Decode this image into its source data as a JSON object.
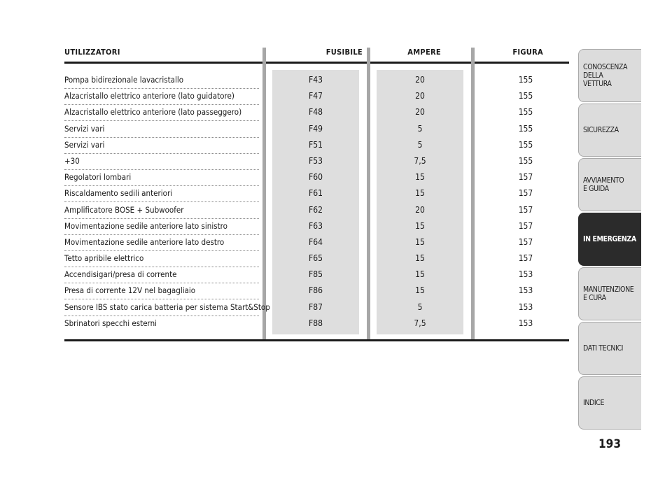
{
  "table": {
    "headers": {
      "utilizzatori": "UTILIZZATORI",
      "fusibile": "FUSIBILE",
      "ampere": "AMPERE",
      "figura": "FIGURA"
    },
    "rows": [
      {
        "desc": "Pompa bidirezionale lavacristallo",
        "fuse": "F43",
        "amp": "20",
        "fig": "155"
      },
      {
        "desc": "Alzacristallo elettrico anteriore (lato guidatore)",
        "fuse": "F47",
        "amp": "20",
        "fig": "155"
      },
      {
        "desc": "Alzacristallo elettrico anteriore (lato passeggero)",
        "fuse": "F48",
        "amp": "20",
        "fig": "155"
      },
      {
        "desc": "Servizi vari",
        "fuse": "F49",
        "amp": "5",
        "fig": "155"
      },
      {
        "desc": "Servizi vari",
        "fuse": "F51",
        "amp": "5",
        "fig": "155"
      },
      {
        "desc": "+30",
        "fuse": "F53",
        "amp": "7,5",
        "fig": "155"
      },
      {
        "desc": "Regolatori lombari",
        "fuse": "F60",
        "amp": "15",
        "fig": "157"
      },
      {
        "desc": "Riscaldamento sedili anteriori",
        "fuse": "F61",
        "amp": "15",
        "fig": "157"
      },
      {
        "desc": "Amplificatore BOSE + Subwoofer",
        "fuse": "F62",
        "amp": "20",
        "fig": "157"
      },
      {
        "desc": "Movimentazione sedile anteriore lato sinistro",
        "fuse": "F63",
        "amp": "15",
        "fig": "157"
      },
      {
        "desc": "Movimentazione sedile anteriore lato destro",
        "fuse": "F64",
        "amp": "15",
        "fig": "157"
      },
      {
        "desc": "Tetto apribile elettrico",
        "fuse": "F65",
        "amp": "15",
        "fig": "157"
      },
      {
        "desc": "Accendisigari/presa di corrente",
        "fuse": "F85",
        "amp": "15",
        "fig": "153"
      },
      {
        "desc": "Presa di corrente 12V nel bagagliaio",
        "fuse": "F86",
        "amp": "15",
        "fig": "153"
      },
      {
        "desc": "Sensore IBS stato carica batteria per sistema Start&Stop",
        "fuse": "F87",
        "amp": "5",
        "fig": "153"
      },
      {
        "desc": "Sbrinatori specchi esterni",
        "fuse": "F88",
        "amp": "7,5",
        "fig": "153"
      }
    ]
  },
  "tabs": [
    {
      "label": "CONOSCENZA\nDELLA\nVETTURA",
      "active": false
    },
    {
      "label": "SICUREZZA",
      "active": false
    },
    {
      "label": "AVVIAMENTO\nE GUIDA",
      "active": false
    },
    {
      "label": "IN EMERGENZA",
      "active": true
    },
    {
      "label": "MANUTENZIONE\nE CURA",
      "active": false
    },
    {
      "label": "DATI TECNICI",
      "active": false
    },
    {
      "label": "INDICE",
      "active": false
    }
  ],
  "page_number": "193",
  "colors": {
    "panel": "#dedede",
    "separator": "#a7a7a7",
    "active_tab": "#2b2b2b",
    "tab": "#dcdcdc"
  }
}
